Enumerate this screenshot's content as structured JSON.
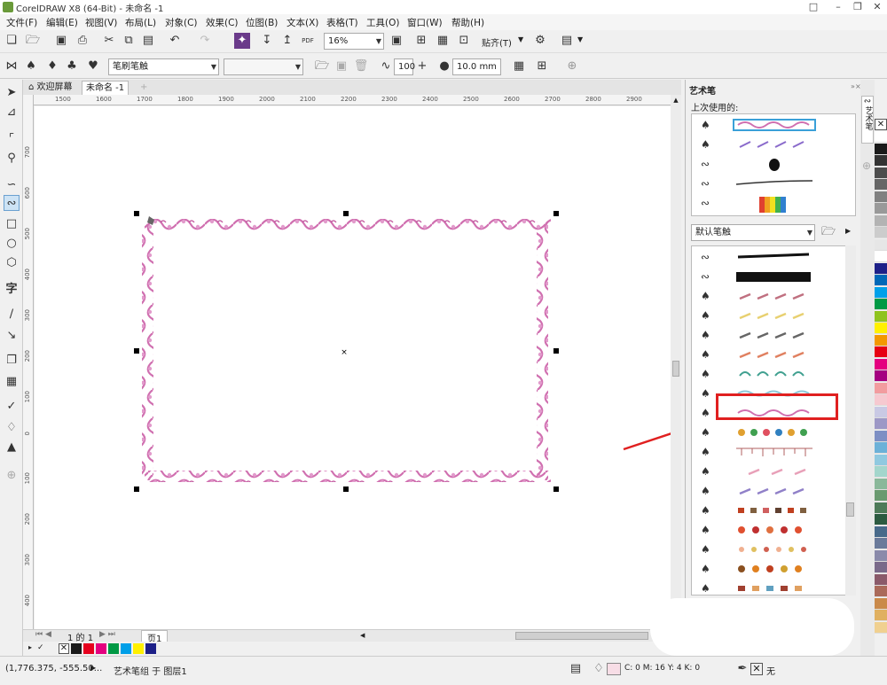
{
  "window": {
    "title": "CorelDRAW X8 (64-Bit) - 未命名 -1"
  },
  "menu": [
    "文件(F)",
    "编辑(E)",
    "视图(V)",
    "布局(L)",
    "对象(C)",
    "效果(C)",
    "位图(B)",
    "文本(X)",
    "表格(T)",
    "工具(O)",
    "窗口(W)",
    "帮助(H)"
  ],
  "toolbar": {
    "zoom": "16%",
    "pdf_label": "PDF",
    "snap_label": "贴齐(T)"
  },
  "propbar": {
    "brush_type": "笔刷笔触",
    "smoothing": "100",
    "width": "10.0 mm"
  },
  "doc_tabs": {
    "welcome": "欢迎屏幕",
    "active": "未命名 -1"
  },
  "ruler": {
    "h_ticks": [
      "1500",
      "1600",
      "1700",
      "1800",
      "1900",
      "2000",
      "2100",
      "2200",
      "2300",
      "2400",
      "2500",
      "2600",
      "2700",
      "2800",
      "2900"
    ],
    "v_ticks": [
      "700",
      "600",
      "500",
      "400",
      "300",
      "200",
      "100",
      "0",
      "100",
      "200",
      "300",
      "400",
      "500"
    ]
  },
  "pages": {
    "counter": "1 的 1",
    "page_tab": "页1"
  },
  "docker": {
    "title": "艺术笔",
    "recent_label": "上次使用的:",
    "category": "默认笔触",
    "side_tab": "艺术笔"
  },
  "status": {
    "coords": "(1,776.375, -555.50...",
    "object_info": "艺术笔组 于 图层1",
    "color_info": "C: 0 M: 16 Y: 4 K: 0",
    "outline_none": "无"
  },
  "colors": {
    "brush_pink": "#d070b0",
    "highlight_red": "#e02020",
    "selection_blue": "#3aa0d8",
    "fill_swatch": "#f7dde6"
  },
  "palette_bottom": [
    "#1a1a1a",
    "#e6001e",
    "#e4007f",
    "#009944",
    "#009fe8",
    "#fff000",
    "#1d2088"
  ],
  "palette_right": [
    "#ffffff",
    "#1a1a1a",
    "#333333",
    "#4d4d4d",
    "#666666",
    "#808080",
    "#999999",
    "#b3b3b3",
    "#cccccc",
    "#e6e6e6",
    "#ffffff",
    "#1d2088",
    "#0068b7",
    "#00a0e9",
    "#009944",
    "#8fc31f",
    "#fff000",
    "#f39800",
    "#e60012",
    "#e4007f",
    "#a40080",
    "#f29c9f",
    "#f6c9d0",
    "#c9c9e4",
    "#9d98c6",
    "#7d8fc4",
    "#6cb1d8",
    "#90c9e0",
    "#a3d6cc",
    "#8ab89a",
    "#6a9a70",
    "#4d7a58",
    "#2c5a40",
    "#486a8a",
    "#6a7a9a",
    "#8a8aaa",
    "#7a6a8a",
    "#8a5a6a",
    "#aa6a5a",
    "#ca8a4a",
    "#e0b060",
    "#f0d090"
  ]
}
